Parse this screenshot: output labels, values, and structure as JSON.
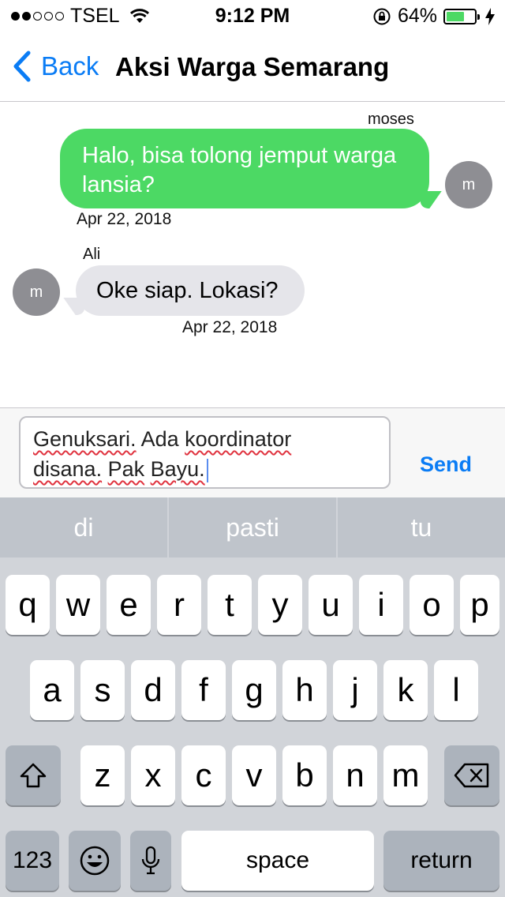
{
  "status": {
    "carrier": "TSEL",
    "time": "9:12 PM",
    "battery": "64%",
    "battery_level": 0.64,
    "signal_filled": 2,
    "signal_total": 5
  },
  "nav": {
    "back": "Back",
    "title": "Aksi Warga Semarang"
  },
  "messages": [
    {
      "sender": "moses",
      "text": "Halo, bisa tolong jemput warga lansia?",
      "avatar": "m",
      "time": "Apr 22, 2018",
      "direction": "outgoing"
    },
    {
      "sender": "Ali",
      "text": "Oke siap. Lokasi?",
      "avatar": "m",
      "time": "Apr 22, 2018",
      "direction": "incoming"
    }
  ],
  "composer": {
    "words": [
      "Genuksari.",
      "Ada",
      "koordinator",
      "disana.",
      "Pak",
      "Bayu."
    ],
    "send": "Send"
  },
  "keyboard": {
    "suggestions": [
      "di",
      "pasti",
      "tu"
    ],
    "row1": [
      "q",
      "w",
      "e",
      "r",
      "t",
      "y",
      "u",
      "i",
      "o",
      "p"
    ],
    "row2": [
      "a",
      "s",
      "d",
      "f",
      "g",
      "h",
      "j",
      "k",
      "l"
    ],
    "row3": [
      "z",
      "x",
      "c",
      "v",
      "b",
      "n",
      "m"
    ],
    "numbers": "123",
    "space": "space",
    "return": "return"
  }
}
